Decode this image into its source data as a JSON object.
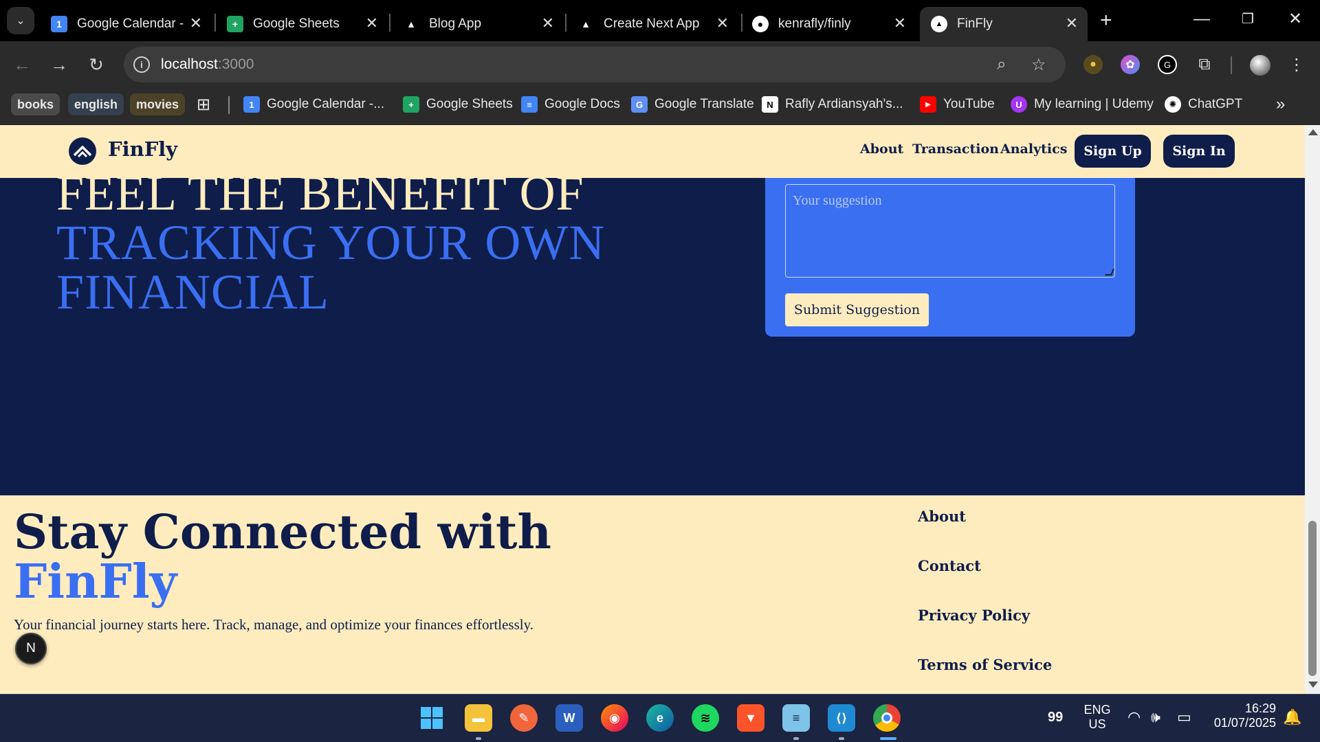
{
  "browser": {
    "tabs": [
      {
        "title": "Google Calendar -",
        "favicon": "calendar-icon"
      },
      {
        "title": "Google Sheets",
        "favicon": "sheets-icon"
      },
      {
        "title": "Blog App",
        "favicon": "triangle-icon"
      },
      {
        "title": "Create Next App",
        "favicon": "triangle-icon"
      },
      {
        "title": "kenrafly/finly",
        "favicon": "github-icon"
      },
      {
        "title": "FinFly",
        "favicon": "triangle-icon"
      }
    ],
    "url_host": "localhost",
    "url_port": ":3000",
    "bookmarks": {
      "folders": [
        "books",
        "english",
        "movies"
      ],
      "items": [
        "Google Calendar -...",
        "Google Sheets",
        "Google Docs",
        "Google Translate",
        "Rafly Ardiansyah's...",
        "YouTube",
        "My learning | Udemy",
        "ChatGPT"
      ]
    }
  },
  "site": {
    "brand": "FinFly",
    "nav": {
      "about": "About",
      "transaction": "Transaction",
      "analytics": "Analytics",
      "signup": "Sign Up",
      "signin": "Sign In"
    },
    "hero": {
      "line1": "FEEL THE BENEFIT OF",
      "line2": "TRACKING YOUR OWN",
      "line3": "FINANCIAL"
    },
    "suggestion": {
      "placeholder": "Your suggestion",
      "submit": "Submit Suggestion"
    },
    "footer": {
      "title": "Stay Connected with",
      "brand": "FinFly",
      "description": "Your financial journey starts here. Track, manage, and optimize your finances effortlessly.",
      "links": [
        "About",
        "Contact",
        "Privacy Policy",
        "Terms of Service"
      ]
    },
    "next_badge": "N"
  },
  "taskbar": {
    "badge": "99",
    "lang_line1": "ENG",
    "lang_line2": "US",
    "time": "16:29",
    "date": "01/07/2025"
  },
  "colors": {
    "navy": "#0f1d4a",
    "cream": "#feecbf",
    "blue": "#3a6ff2"
  }
}
